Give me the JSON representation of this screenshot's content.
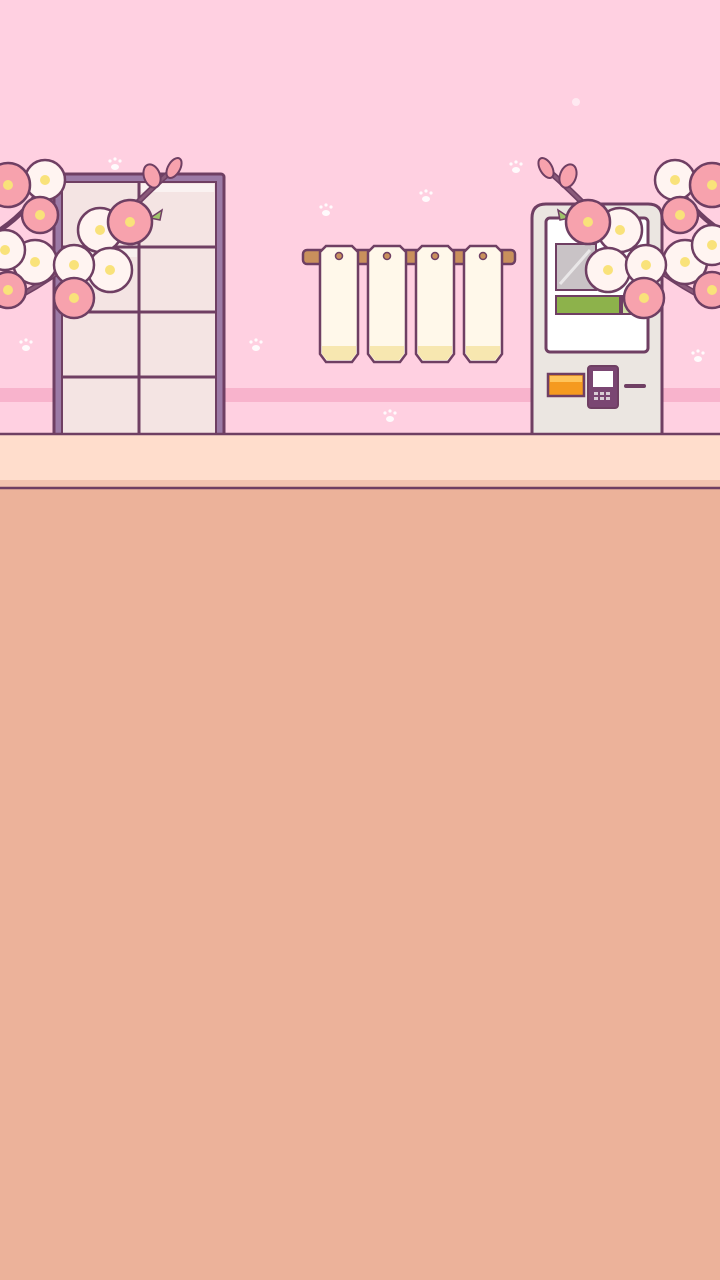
{
  "scene": {
    "colors": {
      "wall": "#ffd0e1",
      "wall_stripe": "#f8b3cc",
      "counter_top": "#ffddcc",
      "floor": "#ecb29a",
      "outline": "#6f3f63",
      "blossom_pink": "#f7a2ad",
      "blossom_white": "#fff4f1",
      "blossom_center": "#f9e27a",
      "shoji_frame": "#9c7aa6",
      "shoji_paper": "#f4e4e3",
      "tag_paper": "#fff8ea",
      "tag_base": "#f7e7b0",
      "rod": "#c9905c",
      "machine_body": "#ebe6e1",
      "machine_screen_green": "#8db24b",
      "machine_orange": "#f59a1f"
    },
    "elements": {
      "shoji_door": "shoji-door",
      "hanging_tags": "hanging-tags",
      "ticket_machine": "ticket-vending-machine",
      "paw_prints": "paw-print-icon"
    },
    "tag_count": 4
  }
}
